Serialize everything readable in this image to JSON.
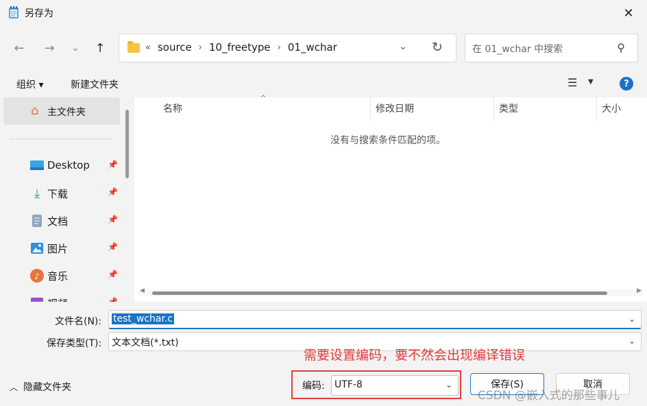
{
  "window": {
    "title": "另存为"
  },
  "nav": {
    "breadcrumb": [
      "source",
      "10_freetype",
      "01_wchar"
    ],
    "overflow": "«",
    "search_placeholder": "在 01_wchar 中搜索"
  },
  "toolbar": {
    "organize": "组织 ▾",
    "new_folder": "新建文件夹",
    "help": "?"
  },
  "sidebar": {
    "home": "主文件夹",
    "items": [
      {
        "label": "Desktop",
        "icon": "desktop-icon"
      },
      {
        "label": "下载",
        "icon": "download-icon"
      },
      {
        "label": "文档",
        "icon": "document-icon"
      },
      {
        "label": "图片",
        "icon": "picture-icon"
      },
      {
        "label": "音乐",
        "icon": "music-icon"
      },
      {
        "label": "视频",
        "icon": "video-icon"
      }
    ]
  },
  "filelist": {
    "columns": [
      "名称",
      "修改日期",
      "类型",
      "大小"
    ],
    "empty_message": "没有与搜索条件匹配的项。"
  },
  "form": {
    "filename_label": "文件名(N):",
    "filename_value": "test_wchar.c",
    "type_label": "保存类型(T):",
    "type_value": "文本文档(*.txt)",
    "encoding_label": "编码:",
    "encoding_value": "UTF-8",
    "hide_folders": "隐藏文件夹",
    "save": "保存(S)",
    "cancel": "取消"
  },
  "annotation": {
    "note": "需要设置编码，要不然会出现编译错误",
    "color": "#e43a3a"
  },
  "watermark": "CSDN @嵌入式的那些事儿",
  "colors": {
    "accent": "#1a73c8",
    "background": "#f3f3f3"
  }
}
